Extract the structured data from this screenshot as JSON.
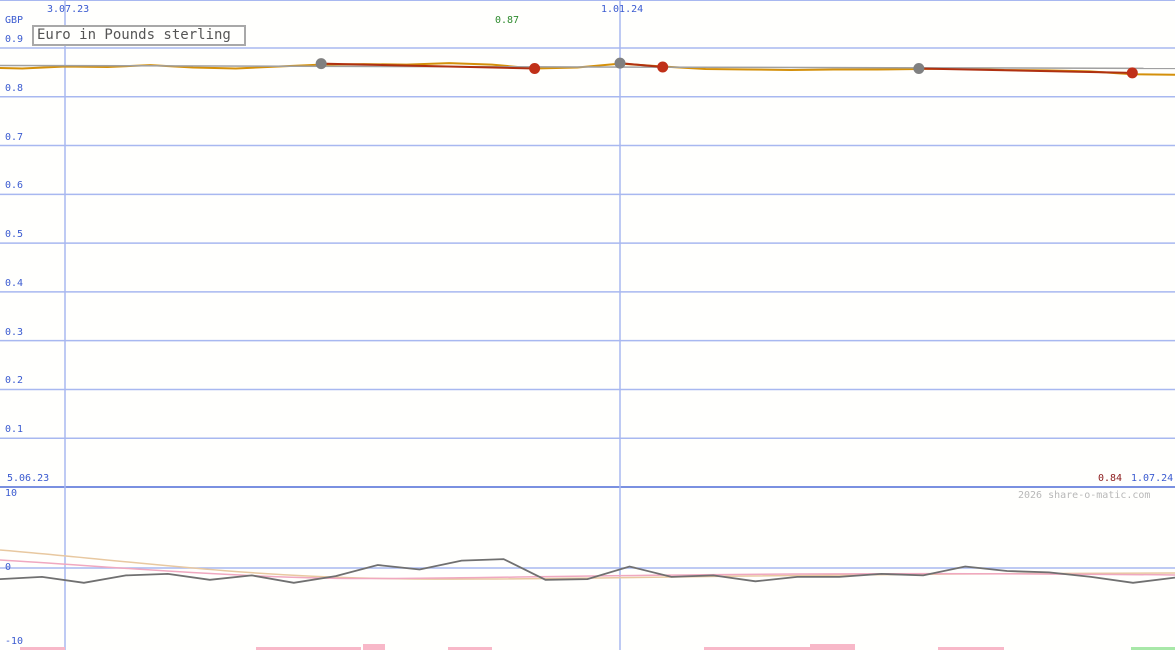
{
  "chart_data": [
    {
      "type": "line",
      "title": "Euro in Pounds sterling",
      "ylabel": "GBP",
      "ylim": [
        0,
        0.9
      ],
      "y_ticks": [
        "0.9",
        "0.8",
        "0.7",
        "0.6",
        "0.5",
        "0.4",
        "0.3",
        "0.2",
        "0.1"
      ],
      "x_range": [
        "5.06.23",
        "1.07.24"
      ],
      "x_tick_labels": [
        "3.07.23",
        "1.01.24"
      ],
      "grid": true,
      "annotations": {
        "max_value": "0.87",
        "last_value": "0.84"
      },
      "colors": {
        "grid": "#a8b8f0",
        "axis_text": "#3b5bd0",
        "max_text": "#2e8b2e",
        "last_text": "#8b1a1a",
        "price": "#d4900a",
        "avg": "#a0a0a0",
        "trend": "#b03010",
        "marker_grey": "#808080",
        "marker_red": "#c03018"
      },
      "series": [
        {
          "name": "",
          "x": [
            "5.06.23",
            "19.06.23",
            "3.07.23",
            "17.07.23",
            "31.07.23",
            "14.08.23",
            "28.08.23",
            "11.09.23",
            "25.09.23",
            "9.10.23",
            "23.10.23",
            "6.11.23",
            "20.11.23",
            "4.12.23",
            "18.12.23",
            "1.01.24",
            "15.01.24",
            "29.01.24",
            "12.02.24",
            "26.02.24",
            "11.03.24",
            "25.03.24",
            "8.04.24",
            "22.04.24",
            "6.05.24",
            "20.05.24",
            "3.06.24",
            "17.06.24",
            "1.07.24"
          ],
          "values": [
            0.86,
            0.858,
            0.862,
            0.861,
            0.865,
            0.86,
            0.858,
            0.862,
            0.866,
            0.867,
            0.866,
            0.869,
            0.866,
            0.858,
            0.86,
            0.868,
            0.862,
            0.857,
            0.856,
            0.855,
            0.856,
            0.856,
            0.857,
            0.858,
            0.855,
            0.854,
            0.852,
            0.846,
            0.845
          ]
        }
      ],
      "markers": [
        {
          "x": "25.09.23",
          "y": 0.868,
          "kind": "grey"
        },
        {
          "x": "4.12.23",
          "y": 0.858,
          "kind": "red"
        },
        {
          "x": "1.01.24",
          "y": 0.869,
          "kind": "grey"
        },
        {
          "x": "15.01.24",
          "y": 0.861,
          "kind": "red"
        },
        {
          "x": "8.04.24",
          "y": 0.858,
          "kind": "grey"
        },
        {
          "x": "17.06.24",
          "y": 0.849,
          "kind": "red"
        }
      ]
    },
    {
      "type": "line",
      "ylim": [
        -10,
        10
      ],
      "y_ticks": [
        "10",
        "0",
        "-10"
      ],
      "copyright": "2026 share-o-matic.com",
      "series": [
        {
          "name": "",
          "values": [
            -1.5,
            -1.2,
            -2.0,
            -1.0,
            -0.8,
            -1.6,
            -1.0,
            -2.0,
            -1.1,
            0.4,
            -0.2,
            1.0,
            1.2,
            -1.6,
            -1.5,
            0.2,
            -1.2,
            -1.0,
            -1.8,
            -1.2,
            -1.2,
            -0.8,
            -1.0,
            0.2,
            -0.4,
            -0.6,
            -1.2,
            -2.0,
            -1.3
          ]
        }
      ]
    }
  ]
}
